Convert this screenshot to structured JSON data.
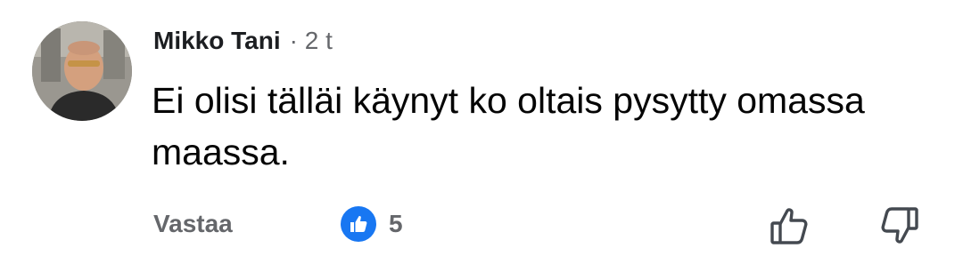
{
  "comment": {
    "author": "Mikko Tani",
    "time": "· 2 t",
    "text": "Ei olisi tälläi käynyt ko oltais pysytty omassa maassa.",
    "reply_label": "Vastaa",
    "reaction_count": "5",
    "reaction_icon": "like-icon"
  },
  "colors": {
    "like_blue": "#1877f2",
    "secondary_text": "#65676b",
    "primary_text": "#050505"
  }
}
